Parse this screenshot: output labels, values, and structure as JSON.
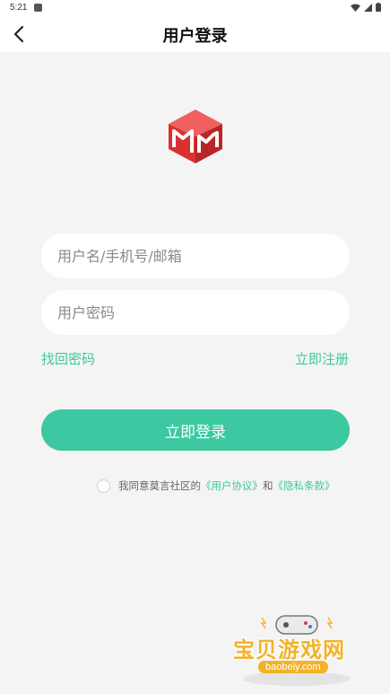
{
  "status_bar": {
    "time": "5:21"
  },
  "header": {
    "title": "用户登录"
  },
  "login_form": {
    "username_placeholder": "用户名/手机号/邮箱",
    "password_placeholder": "用户密码",
    "forgot_password": "找回密码",
    "register": "立即注册",
    "submit_label": "立即登录"
  },
  "agreement": {
    "prefix": "我同意莫言社区的",
    "user_agreement": "《用户协议》",
    "conjunction": "和",
    "privacy_terms": "《隐私条款》"
  },
  "watermark": {
    "title": "宝贝游戏网",
    "url": "baobeiy.com"
  },
  "colors": {
    "accent": "#3cc8a0",
    "logo_red": "#e03a3a"
  }
}
